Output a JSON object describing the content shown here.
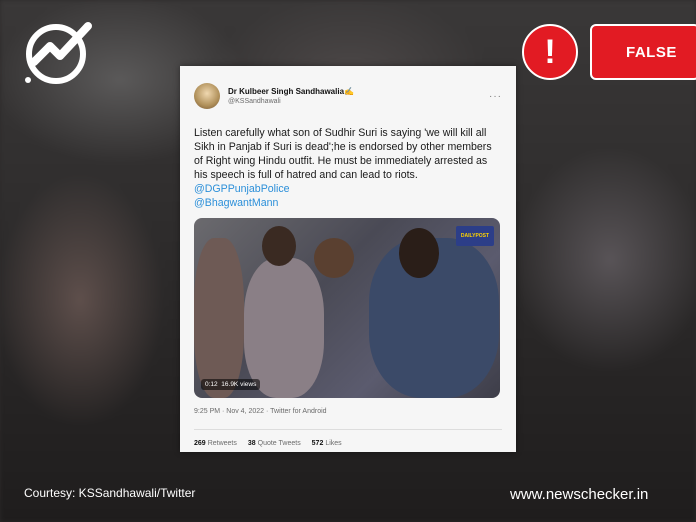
{
  "badge": {
    "alert_symbol": "!",
    "verdict": "FALSE",
    "color": "#e21b23"
  },
  "tweet": {
    "author_name": "Dr Kulbeer Singh Sandhawalia✍",
    "author_handle": "@KSSandhawali",
    "more": "···",
    "text_main": "Listen carefully what son of Sudhir Suri  is saying 'we will kill all Sikh in Panjab if Suri is dead';he is endorsed by other members of Right wing Hindu outfit. He must be immediately arrested as his speech is full of hatred and can lead to riots.",
    "mention_1": "@DGPPunjabPolice",
    "mention_2": "@BhagwantMann",
    "video_time": "0:12",
    "video_views": "16.9K views",
    "video_channel": "DAILYPOST",
    "timestamp": "9:25 PM · Nov 4, 2022 · Twitter for Android",
    "retweets_count": "269",
    "retweets_label": "Retweets",
    "quotes_count": "38",
    "quotes_label": "Quote Tweets",
    "likes_count": "572",
    "likes_label": "Likes"
  },
  "footer": {
    "courtesy": "Courtesy: KSSandhawali/Twitter",
    "site": "www.newschecker.in"
  },
  "icons": {
    "logo": "newschecker-logo-icon",
    "alert": "exclamation-icon"
  }
}
